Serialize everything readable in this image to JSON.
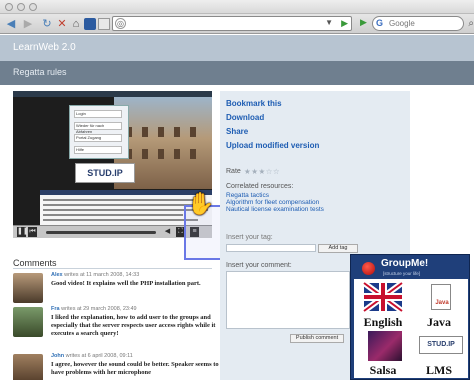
{
  "browser": {
    "search_placeholder": "Google",
    "url_placeholder": "",
    "nav": {
      "back": "◀",
      "forward": "▶",
      "reload": "↻",
      "stop": "✕",
      "home": "⌂"
    }
  },
  "site": {
    "title": "LearnWeb 2.0"
  },
  "page": {
    "title": "Regatta rules"
  },
  "video": {
    "login_rows": [
      "Login",
      "Wieder für nach Abfahren",
      "Portal Zugang",
      "Hilfe"
    ],
    "logo_text": "STUD.IP"
  },
  "actions": {
    "bookmark": "Bookmark this",
    "download": "Download",
    "share": "Share",
    "upload": "Upload modified version"
  },
  "rating": {
    "label": "Rate",
    "stars": "★★★☆☆"
  },
  "correlated": {
    "label": "Correlated resources:",
    "items": [
      "Regatta tactics",
      "Algorithm for fleet compensation",
      "Nautical license examination tests"
    ]
  },
  "tag": {
    "label": "Insert your tag:",
    "button": "Add tag"
  },
  "comment_form": {
    "label": "Insert your comment:",
    "button": "Publish comment"
  },
  "comments": {
    "title": "Comments",
    "items": [
      {
        "author": "Alex",
        "meta": "writes at 11 march 2008, 14:33",
        "text": "Good video! It explains well the PHP installation part."
      },
      {
        "author": "Fra",
        "meta": "writes at 29 march 2008, 23:49",
        "text": "I liked the explanation, how to add user to the groups and especially that the server respects user access rights while it executes a search query!"
      },
      {
        "author": "John",
        "meta": "writes at 6 april 2008, 09:11",
        "text": "I agree, however the sound could be better. Speaker seems to have problems with her microphone"
      }
    ]
  },
  "groupme": {
    "title": "GroupMe!",
    "subtitle": "[structure your life]",
    "tiles": [
      {
        "label": "English"
      },
      {
        "label": "Java",
        "badge": "Java"
      },
      {
        "label": "Salsa"
      },
      {
        "label": "LMS",
        "badge": "STUD.IP"
      }
    ]
  },
  "colors": {
    "accent_link": "#1e5db3",
    "header_band": "#6f7f8f",
    "groupme_bg": "#1f3f7a"
  }
}
